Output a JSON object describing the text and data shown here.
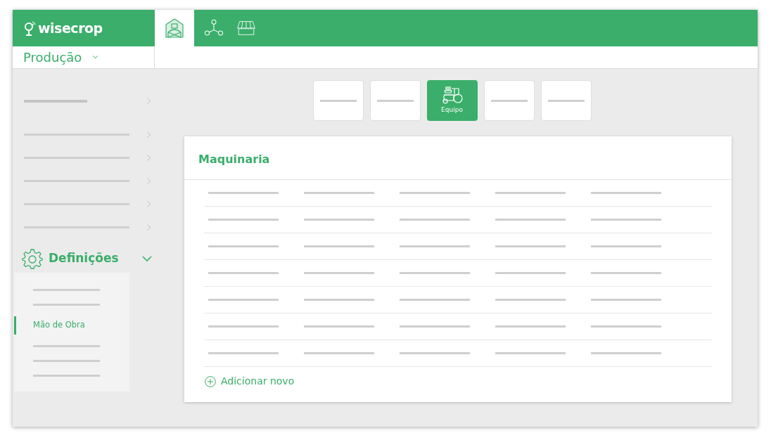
{
  "header": {
    "logo": "wisecrop",
    "nav": [
      {
        "kind": "barn",
        "selected": true
      },
      {
        "kind": "network",
        "selected": false
      },
      {
        "kind": "store",
        "selected": false
      }
    ]
  },
  "subheader": {
    "dropdown": "Produção"
  },
  "sidebar": {
    "items": [
      {
        "kind": "heading"
      },
      {
        "kind": "line"
      },
      {
        "kind": "line"
      },
      {
        "kind": "line"
      },
      {
        "kind": "line"
      },
      {
        "kind": "line"
      }
    ],
    "section": {
      "label": "Definições",
      "expanded": true,
      "children": [
        {
          "kind": "line",
          "selected": false
        },
        {
          "kind": "line",
          "selected": false
        },
        {
          "kind": "text",
          "label": "Mão de Obra",
          "selected": true
        },
        {
          "kind": "line",
          "selected": false
        },
        {
          "kind": "line",
          "selected": false
        },
        {
          "kind": "line",
          "selected": false
        }
      ]
    }
  },
  "categories": [
    {
      "selected": false
    },
    {
      "selected": false
    },
    {
      "selected": true,
      "label": "Equipo"
    },
    {
      "selected": false
    },
    {
      "selected": false
    }
  ],
  "card": {
    "title": "Maquinaria",
    "add_label": "Adicionar novo"
  }
}
